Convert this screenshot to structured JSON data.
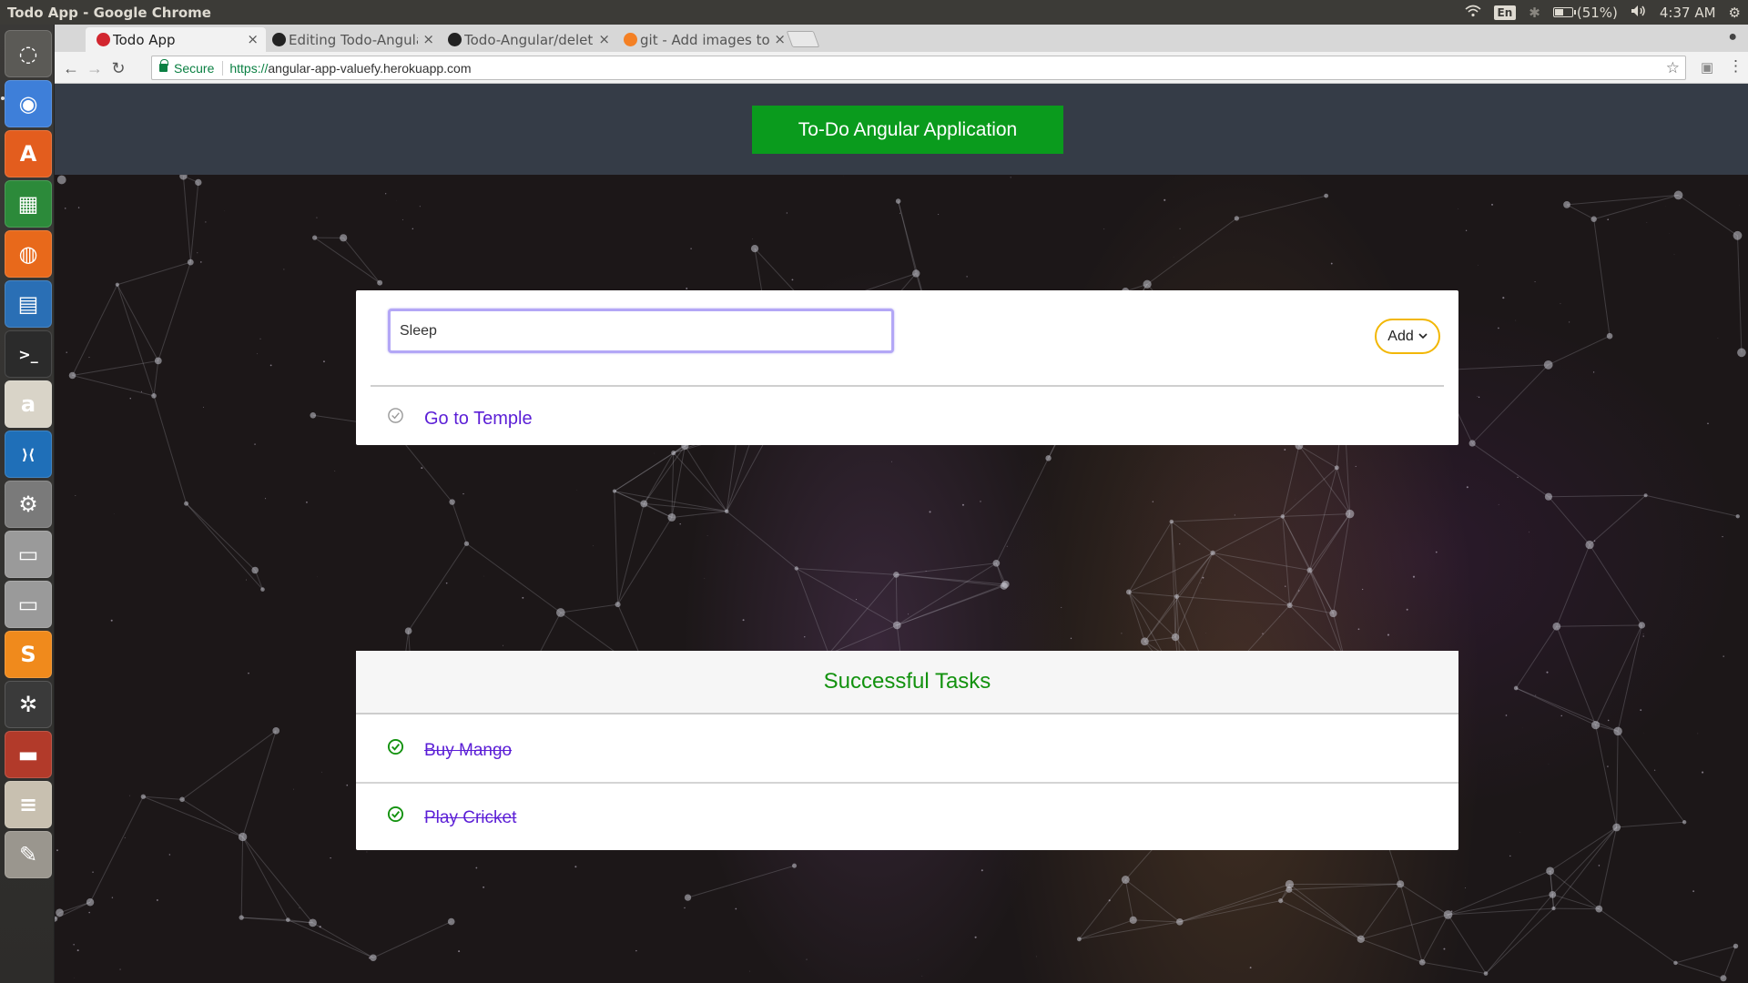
{
  "os_panel": {
    "window_title": "Todo App - Google Chrome",
    "keyboard_layout": "En",
    "battery": "(51%)",
    "battery_level": 0.51,
    "clock": "4:37 AM"
  },
  "launcher": {
    "apps": [
      {
        "name": "ubuntu-dash",
        "color": "#5b5a56",
        "glyph": "◌"
      },
      {
        "name": "chrome",
        "color": "#3e7fd9",
        "glyph": "◉"
      },
      {
        "name": "software-center",
        "color": "#e35d1e",
        "glyph": "A"
      },
      {
        "name": "libreoffice-calc",
        "color": "#2c8a3a",
        "glyph": "▦"
      },
      {
        "name": "firefox",
        "color": "#e8691b",
        "glyph": "◍"
      },
      {
        "name": "libreoffice-impress",
        "color": "#2a6fb5",
        "glyph": "▤"
      },
      {
        "name": "terminal",
        "color": "#2b2b2b",
        "glyph": ">_"
      },
      {
        "name": "amazon",
        "color": "#d9d4c8",
        "glyph": "a"
      },
      {
        "name": "vscode",
        "color": "#1f6fb8",
        "glyph": "⟩⟨"
      },
      {
        "name": "system-settings",
        "color": "#7a7a7a",
        "glyph": "⚙"
      },
      {
        "name": "disk-1",
        "color": "#9a9a9a",
        "glyph": "▭"
      },
      {
        "name": "disk-2",
        "color": "#9a9a9a",
        "glyph": "▭"
      },
      {
        "name": "sublime-text",
        "color": "#f08a1c",
        "glyph": "S"
      },
      {
        "name": "network-app",
        "color": "#3a3a3a",
        "glyph": "✲"
      },
      {
        "name": "file-manager",
        "color": "#b23a2a",
        "glyph": "▬"
      },
      {
        "name": "document-viewer",
        "color": "#c8c0b0",
        "glyph": "≡"
      },
      {
        "name": "text-editor",
        "color": "#9a968e",
        "glyph": "✎"
      }
    ]
  },
  "browser": {
    "tabs": [
      {
        "label": "Todo App",
        "favicon_color": "#d2262f",
        "active": true
      },
      {
        "label": "Editing Todo-Angular",
        "favicon_color": "#222222",
        "active": false
      },
      {
        "label": "Todo-Angular/delete",
        "favicon_color": "#222222",
        "active": false
      },
      {
        "label": "git - Add images to",
        "favicon_color": "#f48024",
        "active": false
      }
    ],
    "secure_label": "Secure",
    "url_scheme": "https://",
    "url_host": "angular-app-valuefy.herokuapp.com"
  },
  "app": {
    "title": "To-Do Angular Application",
    "task_input": {
      "value": "Sleep",
      "placeholder": ""
    },
    "add_button_label": "Add",
    "pending_tasks": [
      {
        "label": "Go to Temple"
      }
    ],
    "successful_tasks_heading": "Successful Tasks",
    "completed_tasks": [
      {
        "label": "Buy Mango"
      },
      {
        "label": "Play Cricket"
      }
    ]
  },
  "colors": {
    "header_bar": "#353c47",
    "title_button": "#0a9b1d",
    "task_text": "#5b1ed6",
    "success_green": "#13920f",
    "add_border": "#f2b705",
    "input_focus": "#b3a7f6"
  }
}
